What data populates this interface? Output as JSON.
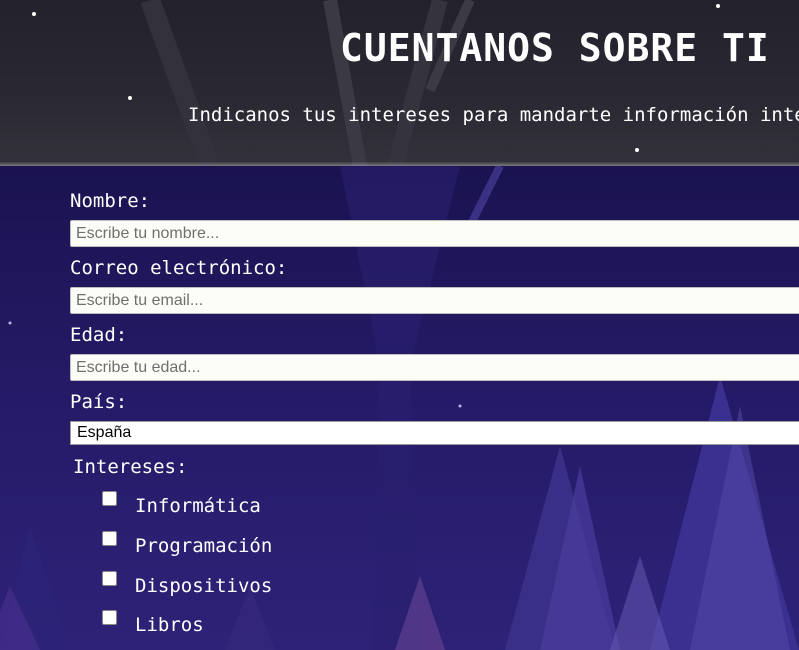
{
  "header": {
    "title": "CUENTANOS SOBRE TI",
    "subtitle": "Indicanos tus intereses para mandarte información interesante"
  },
  "form": {
    "name": {
      "label": "Nombre:",
      "placeholder": "Escribe tu nombre..."
    },
    "email": {
      "label": "Correo electrónico:",
      "placeholder": "Escribe tu email..."
    },
    "age": {
      "label": "Edad:",
      "placeholder": "Escribe tu edad..."
    },
    "country": {
      "label": "País:",
      "selected": "España"
    },
    "interests": {
      "label": "Intereses:",
      "items": [
        {
          "label": "Informática",
          "checked": false
        },
        {
          "label": "Programación",
          "checked": false
        },
        {
          "label": "Dispositivos",
          "checked": false
        },
        {
          "label": "Libros",
          "checked": false
        }
      ]
    }
  },
  "colors": {
    "header_bg": "#2a2933",
    "form_bg": "#1c1454",
    "text": "#ffffff",
    "input_bg": "#fdfdf8"
  }
}
